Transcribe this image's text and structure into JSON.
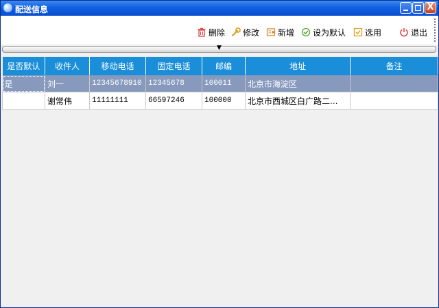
{
  "window": {
    "title": "配送信息",
    "close_glyph": "X"
  },
  "toolbar": {
    "delete_label": "删除",
    "edit_label": "修改",
    "add_label": "新增",
    "set_default_label": "设为默认",
    "select_label": "选用",
    "exit_label": "退出"
  },
  "collapse": {
    "arrow": "▼"
  },
  "grid": {
    "columns": [
      "是否默认",
      "收件人",
      "移动电话",
      "固定电话",
      "邮编",
      "地址",
      "备注"
    ],
    "rows": [
      {
        "is_default": "是",
        "recipient": "刘一",
        "mobile": "12345678910",
        "phone": "12345678",
        "zip": "100011",
        "address": "北京市海淀区",
        "note": ""
      },
      {
        "is_default": "",
        "recipient": "谢常伟",
        "mobile": "11111111",
        "phone": "66597246",
        "zip": "100000",
        "address": "北京市西城区白广路二...",
        "note": ""
      }
    ]
  },
  "colors": {
    "titlebar": "#1160e0",
    "header": "#1a8ed8",
    "selected_row": "#8799bd",
    "delete_icon": "#e03c3c",
    "edit_icon": "#e0a020",
    "add_icon": "#e07a20",
    "default_icon": "#5aa030",
    "select_icon": "#e0a020",
    "exit_icon": "#e03c3c"
  }
}
